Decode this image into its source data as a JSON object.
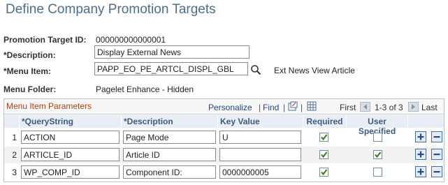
{
  "page_title": "Define Company Promotion Targets",
  "form": {
    "promotion_target_id_label": "Promotion Target ID:",
    "promotion_target_id_value": "000000000000001",
    "description_label": "*Description:",
    "description_value": "Display External News",
    "menu_item_label": "*Menu Item:",
    "menu_item_value": "PAPP_EO_PE_ARTCL_DISPL_GBL",
    "menu_item_description": "Ext News View Article",
    "menu_folder_label": "Menu Folder:",
    "menu_folder_value": "Pagelet Enhance - Hidden"
  },
  "grid": {
    "title": "Menu Item Parameters",
    "personalize_label": "Personalize",
    "find_label": "Find",
    "separator": "|",
    "first_label": "First",
    "range_label": "1-3 of 3",
    "last_label": "Last",
    "columns": {
      "querystring": "*QueryString",
      "description": "*Description",
      "key_value": "Key Value",
      "required": "Required",
      "user_specified": "User Specified"
    },
    "rows": [
      {
        "num": "1",
        "querystring": "ACTION",
        "description": "Page Mode",
        "key_value": "U",
        "required": true,
        "user_specified": false
      },
      {
        "num": "2",
        "querystring": "ARTICLE_ID",
        "description": "Article ID",
        "key_value": "",
        "required": true,
        "user_specified": true
      },
      {
        "num": "3",
        "querystring": "WP_COMP_ID",
        "description": "Component ID:",
        "key_value": "0000000005",
        "required": true,
        "user_specified": false
      }
    ]
  },
  "icons": {
    "lookup": "magnifier-lookup-icon",
    "new_window": "new-window-icon",
    "download": "grid-download-icon",
    "prev": "arrow-left-icon",
    "next": "arrow-right-icon",
    "add_row": "plus-icon",
    "delete_row": "minus-icon"
  },
  "colors": {
    "title": "#4e6e8e",
    "grid_title": "#b5400c",
    "header_text": "#3b5b84",
    "link": "#204a80",
    "checkmark": "#2e7d22"
  }
}
